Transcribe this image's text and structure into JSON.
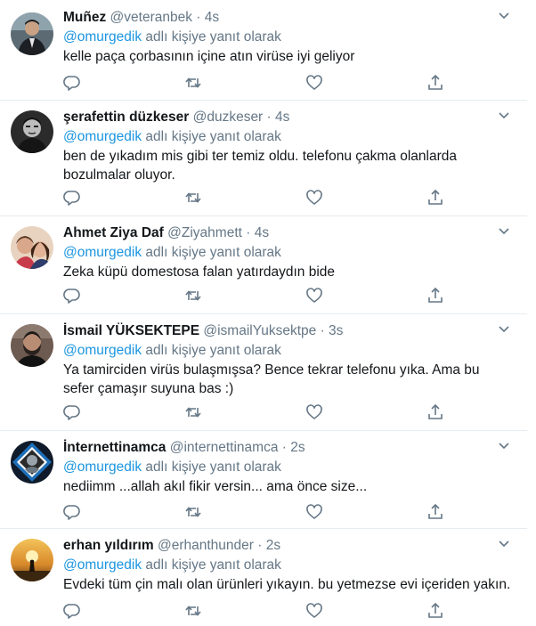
{
  "reply_prefix_suffix": "adlı kişiye yanıt olarak",
  "tweets": [
    {
      "name": "Muñez",
      "handle": "@veteranbek",
      "time": "4s",
      "mention": "@omurgedik",
      "text": "kelle paça çorbasının içine atın virüse iyi geliyor",
      "avatar_icon": "man-in-suit-avatar"
    },
    {
      "name": "şerafettin düzkeser",
      "handle": "@duzkeser",
      "time": "4s",
      "mention": "@omurgedik",
      "text": "ben de yıkadım mis gibi ter temiz oldu. telefonu çakma olanlarda bozulmalar oluyor.",
      "avatar_icon": "bw-portrait-avatar"
    },
    {
      "name": "Ahmet Ziya Daf",
      "handle": "@Ziyahmett",
      "time": "4s",
      "mention": "@omurgedik",
      "text": "Zeka küpü domestosa falan yatırdaydın bide",
      "avatar_icon": "two-people-avatar"
    },
    {
      "name": "İsmail YÜKSEKTEPE",
      "handle": "@ismailYuksektpe",
      "time": "3s",
      "mention": "@omurgedik",
      "text": "Ya tamirciden virüs bulaşmışsa? Bence tekrar telefonu yıka. Ama bu sefer çamaşır suyuna bas :)",
      "avatar_icon": "bearded-man-avatar"
    },
    {
      "name": "İnternettinamca",
      "handle": "@internettinamca",
      "time": "2s",
      "mention": "@omurgedik",
      "text": "nediimm ...allah akıl fikir versin... ama önce size...",
      "avatar_icon": "diamond-logo-avatar"
    },
    {
      "name": "erhan yıldırım",
      "handle": "@erhanthunder",
      "time": "2s",
      "mention": "@omurgedik",
      "text": "Evdeki tüm çin malı olan ürünleri yıkayın. bu yetmezse evi içeriden yakın.",
      "avatar_icon": "sunset-silhouette-avatar"
    }
  ],
  "icons": {
    "reply": "reply-icon",
    "retweet": "retweet-icon",
    "like": "heart-icon",
    "share": "share-icon",
    "more": "chevron-down-icon"
  },
  "colors": {
    "link": "#1b95e0",
    "muted": "#657786",
    "text": "#14171a",
    "divider": "#e6ecf0"
  }
}
